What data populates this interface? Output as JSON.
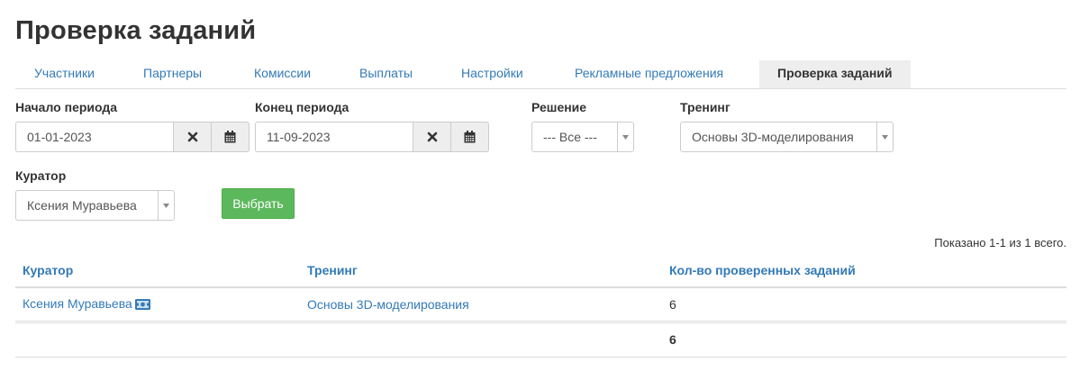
{
  "page": {
    "title": "Проверка заданий"
  },
  "tabs": [
    {
      "label": "Участники"
    },
    {
      "label": "Партнеры"
    },
    {
      "label": "Комиссии"
    },
    {
      "label": "Выплаты"
    },
    {
      "label": "Настройки"
    },
    {
      "label": "Рекламные предложения"
    },
    {
      "label": "Проверка заданий",
      "active": true
    }
  ],
  "filters": {
    "period_start": {
      "label": "Начало периода",
      "value": "01-01-2023"
    },
    "period_end": {
      "label": "Конец периода",
      "value": "11-09-2023"
    },
    "decision": {
      "label": "Решение",
      "value": "--- Все ---"
    },
    "training": {
      "label": "Тренинг",
      "value": "Основы 3D-моделирования"
    },
    "curator": {
      "label": "Куратор",
      "value": "Ксения Муравьева"
    },
    "submit_label": "Выбрать"
  },
  "summary": "Показано 1-1 из 1 всего.",
  "table": {
    "headers": {
      "curator": "Куратор",
      "training": "Тренинг",
      "count": "Кол-во проверенных заданий"
    },
    "rows": [
      {
        "curator": "Ксения Муравьева",
        "training": "Основы 3D-моделирования",
        "count": "6"
      }
    ],
    "total": "6"
  },
  "colors": {
    "link": "#337ab7",
    "button_success": "#5cb85c",
    "tab_active_bg": "#eeeeee"
  }
}
